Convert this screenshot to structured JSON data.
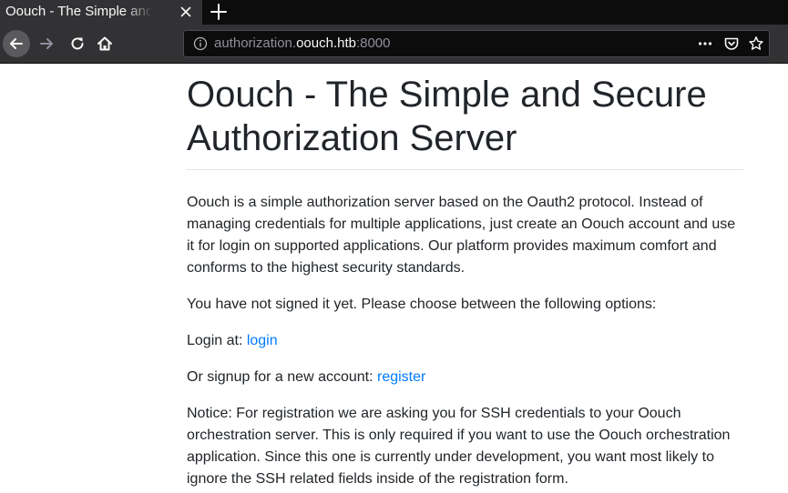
{
  "browser": {
    "tab": {
      "title": "Oouch - The Simple and Secure Authorization Server"
    },
    "url": {
      "prefix": "authorization.",
      "domain": "oouch.htb",
      "port": ":8000"
    },
    "icons": {
      "back": "back-arrow-icon",
      "forward": "forward-arrow-icon",
      "reload": "reload-icon",
      "home": "home-icon",
      "info": "info-icon",
      "more": "more-icon",
      "pocket": "pocket-icon",
      "bookmark": "star-icon",
      "tab_close": "close-icon",
      "new_tab": "plus-icon"
    }
  },
  "page": {
    "title": "Oouch - The Simple and Secure Authorization Server",
    "intro": "Oouch is a simple authorization server based on the Oauth2 protocol. Instead of managing credentials for multiple applications, just create an Oouch account and use it for login on supported applications. Our platform provides maximum comfort and conforms to the highest security standards.",
    "status": "You have not signed it yet. Please choose between the following options:",
    "login": {
      "prefix": "Login at: ",
      "link_text": "login"
    },
    "signup": {
      "prefix": "Or signup for a new account: ",
      "link_text": "register"
    },
    "notice": "Notice: For registration we are asking you for SSH credentials to your Oouch orchestration server. This is only required if you want to use the Oouch orchestration application. Since this one is currently under development, you want most likely to ignore the SSH related fields inside of the registration form."
  },
  "colors": {
    "link": "#007bff",
    "text": "#212529",
    "chrome_dark": "#0c0c0d",
    "chrome": "#323234"
  }
}
